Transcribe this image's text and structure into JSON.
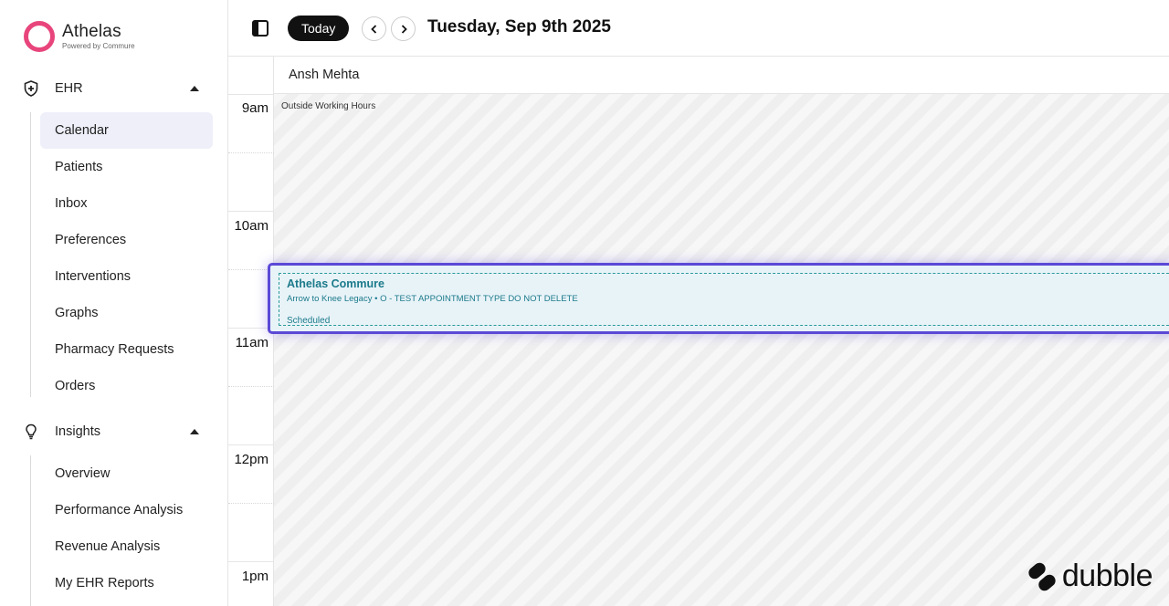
{
  "brand": {
    "name": "Athelas",
    "tagline": "Powered by Commure",
    "color": "#e8457c"
  },
  "sidebar": {
    "ehr": {
      "label": "EHR",
      "icon": "shield-plus-icon",
      "items": [
        {
          "label": "Calendar",
          "active": true
        },
        {
          "label": "Patients"
        },
        {
          "label": "Inbox"
        },
        {
          "label": "Preferences"
        },
        {
          "label": "Interventions"
        },
        {
          "label": "Graphs"
        },
        {
          "label": "Pharmacy Requests"
        },
        {
          "label": "Orders"
        }
      ]
    },
    "insights": {
      "label": "Insights",
      "icon": "lightbulb-icon",
      "items": [
        {
          "label": "Overview"
        },
        {
          "label": "Performance Analysis"
        },
        {
          "label": "Revenue Analysis"
        },
        {
          "label": "My EHR Reports"
        }
      ]
    }
  },
  "header": {
    "today_label": "Today",
    "date": "Tuesday, Sep 9th 2025"
  },
  "calendar": {
    "provider": "Ansh Mehta",
    "outside_hours_label": "Outside Working Hours",
    "times": [
      "9am",
      "10am",
      "11am",
      "12pm",
      "1pm"
    ],
    "appointment": {
      "title": "Athelas Commure",
      "subtitle": "Arrow to Knee Legacy • O - TEST APPOINTMENT TYPE DO NOT DELETE",
      "status": "Scheduled",
      "accent": "#5b49d6",
      "text_color": "#1b7a8a"
    }
  },
  "watermark": {
    "text": "dubble"
  }
}
